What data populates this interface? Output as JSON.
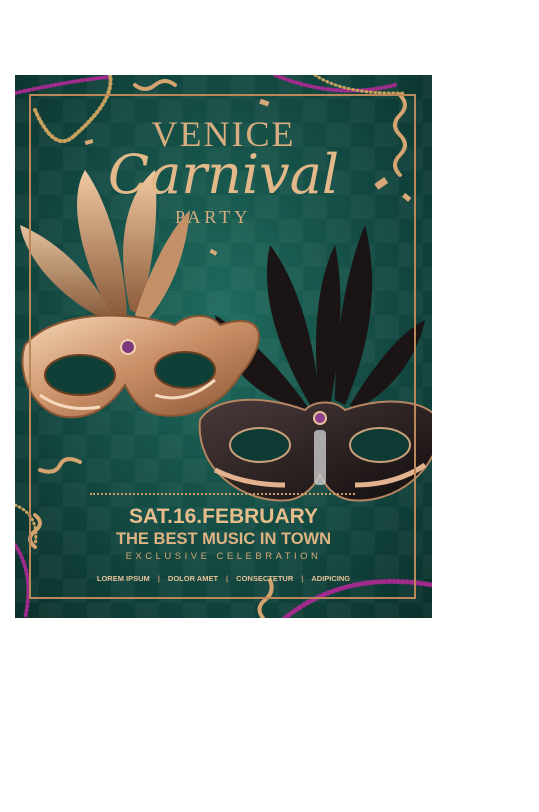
{
  "poster": {
    "title_line1": "VENICE",
    "title_line2": "Carnival",
    "title_line3": "PARTY",
    "date": "SAT.16.FEBRUARY",
    "tagline": "THE BEST MUSIC IN TOWN",
    "subline": "EXCLUSIVE CELEBRATION",
    "footer_items": [
      "LOREM IPSUM",
      "DOLOR AMET",
      "CONSECTETUR",
      "ADIPICING"
    ],
    "separator": "|"
  },
  "colors": {
    "background": "#134a42",
    "gold": "#d8ad7f",
    "purple_beads": "#8a2a7a"
  }
}
